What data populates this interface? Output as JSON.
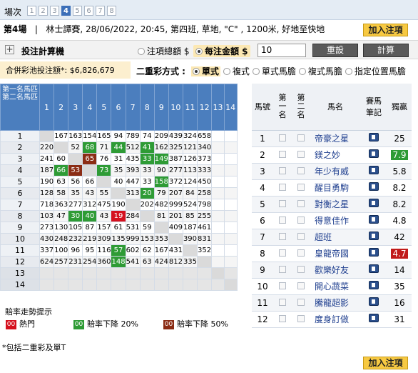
{
  "header": {
    "race_label": "場次",
    "races": [
      "1",
      "2",
      "3",
      "4",
      "5",
      "6",
      "7",
      "8"
    ],
    "current_race": "4"
  },
  "race": {
    "number": "第4場",
    "info": "林士譚賽, 28/06/2022, 20:45, 第四班, 草地, \"C\" , 1200米, 好地至快地"
  },
  "buttons": {
    "add_bet": "加入注項",
    "reset": "重設",
    "calc": "計算"
  },
  "calc": {
    "title": "投注計算機",
    "opt_total": "注項總額 $",
    "opt_unit": "每注金額 $",
    "unit_value": "10"
  },
  "pool": {
    "text": "合併彩池投注額*: $6,826,679"
  },
  "mode": {
    "label": "二重彩方式 :",
    "options": [
      "單式",
      "複式",
      "單式馬膽",
      "複式馬膽",
      "指定位置馬膽"
    ],
    "selected": "單式"
  },
  "grid": {
    "corner_top": "第一名馬匹",
    "corner_bottom": "第二名馬匹",
    "cols": [
      "1",
      "2",
      "3",
      "4",
      "5",
      "6",
      "7",
      "8",
      "9",
      "10",
      "11",
      "12",
      "13",
      "14"
    ],
    "rows": [
      {
        "n": "1",
        "c": [
          "",
          "167",
          "163",
          "154",
          "165",
          "94",
          "789",
          "74",
          "209",
          "439",
          "324",
          "658",
          "",
          ""
        ]
      },
      {
        "n": "2",
        "c": [
          "220",
          "",
          "52",
          "68",
          "71",
          "44",
          "512",
          "41",
          "162",
          "325",
          "121",
          "340",
          "",
          ""
        ]
      },
      {
        "n": "3",
        "c": [
          "241",
          "60",
          "",
          "65",
          "76",
          "31",
          "435",
          "33",
          "149",
          "387",
          "126",
          "373",
          "",
          ""
        ]
      },
      {
        "n": "4",
        "c": [
          "187",
          "66",
          "53",
          "",
          "73",
          "35",
          "393",
          "33",
          "90",
          "277",
          "113",
          "333",
          "",
          ""
        ]
      },
      {
        "n": "5",
        "c": [
          "190",
          "63",
          "56",
          "66",
          "",
          "40",
          "447",
          "33",
          "158",
          "372",
          "124",
          "450",
          "",
          ""
        ]
      },
      {
        "n": "6",
        "c": [
          "128",
          "58",
          "35",
          "43",
          "55",
          "",
          "313",
          "20",
          "79",
          "207",
          "84",
          "258",
          "",
          ""
        ]
      },
      {
        "n": "7",
        "c": [
          "718",
          "363",
          "277",
          "312",
          "475",
          "190",
          "",
          "202",
          "482",
          "999",
          "524",
          "798",
          "",
          ""
        ]
      },
      {
        "n": "8",
        "c": [
          "103",
          "47",
          "30",
          "40",
          "43",
          "19",
          "284",
          "",
          "81",
          "201",
          "85",
          "255",
          "",
          ""
        ]
      },
      {
        "n": "9",
        "c": [
          "273",
          "130",
          "105",
          "87",
          "157",
          "61",
          "531",
          "59",
          "",
          "409",
          "187",
          "461",
          "",
          ""
        ]
      },
      {
        "n": "10",
        "c": [
          "430",
          "248",
          "232",
          "219",
          "309",
          "135",
          "999",
          "153",
          "353",
          "",
          "390",
          "831",
          "",
          ""
        ]
      },
      {
        "n": "11",
        "c": [
          "337",
          "100",
          "96",
          "95",
          "116",
          "57",
          "602",
          "62",
          "167",
          "431",
          "",
          "352",
          "",
          ""
        ]
      },
      {
        "n": "12",
        "c": [
          "624",
          "257",
          "231",
          "254",
          "360",
          "148",
          "541",
          "63",
          "424",
          "812",
          "335",
          "",
          "",
          ""
        ]
      },
      {
        "n": "13",
        "c": [
          "",
          "",
          "",
          "",
          "",
          "",
          "",
          "",
          "",
          "",
          "",
          "",
          "",
          ""
        ]
      },
      {
        "n": "14",
        "c": [
          "",
          "",
          "",
          "",
          "",
          "",
          "",
          "",
          "",
          "",
          "",
          "",
          "",
          ""
        ]
      }
    ]
  },
  "runners": {
    "headers": {
      "no": "馬號",
      "first": "第一名",
      "second": "第二名",
      "name": "馬名",
      "notes": "賽馬筆記",
      "win": "獨贏"
    },
    "list": [
      {
        "no": "1",
        "name": "帝豪之星",
        "win": "25"
      },
      {
        "no": "2",
        "name": "鎂之妙",
        "win": "7.9"
      },
      {
        "no": "3",
        "name": "年少有威",
        "win": "5.8"
      },
      {
        "no": "4",
        "name": "醒目勇駒",
        "win": "8.2"
      },
      {
        "no": "5",
        "name": "對衡之星",
        "win": "8.2"
      },
      {
        "no": "6",
        "name": "得意佳作",
        "win": "4.8"
      },
      {
        "no": "7",
        "name": "超班",
        "win": "42"
      },
      {
        "no": "8",
        "name": "皇龍帝國",
        "win": "4.7"
      },
      {
        "no": "9",
        "name": "歡樂好友",
        "win": "14"
      },
      {
        "no": "10",
        "name": "開心蔬菜",
        "win": "35"
      },
      {
        "no": "11",
        "name": "騰龍超影",
        "win": "16"
      },
      {
        "no": "12",
        "name": "度身訂做",
        "win": "31"
      }
    ]
  },
  "legend": {
    "title": "賠率走勢提示",
    "hot": "熱門",
    "drop20": "賠率下降 20%",
    "drop50": "賠率下降 50%",
    "sample": "00"
  },
  "note": "*包括二重彩及單T"
}
